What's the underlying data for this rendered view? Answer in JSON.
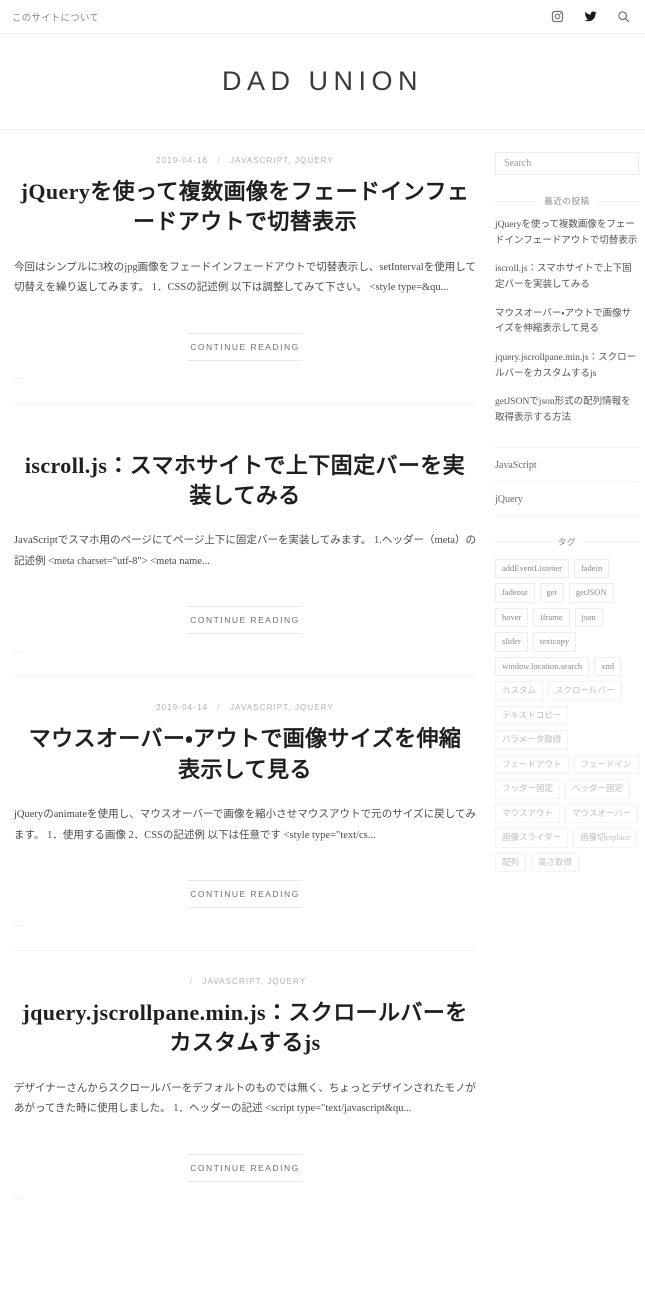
{
  "topbar": {
    "nav": [
      {
        "label": "このサイトについて",
        "name": "nav-about"
      }
    ],
    "icons": [
      {
        "name": "instagram-icon",
        "label": "Instagram"
      },
      {
        "name": "twitter-icon",
        "label": "Twitter"
      },
      {
        "name": "search-icon",
        "label": "Search"
      }
    ]
  },
  "masthead": {
    "site_title": "DAD UNION"
  },
  "posts": [
    {
      "date": "2019-04-16",
      "separator": "/",
      "categories": "JAVASCRIPT, JQUERY",
      "title": "jQueryを使って複数画像をフェードインフェードアウトで切替表示",
      "excerpt": "今回はシンプルに3枚のjpg画像をフェードインフェードアウトで切替表示し、setIntervalを使用して切替えを繰り返してみます。 1．CSSの記述例 以下は調整してみて下さい。 <style type=&qu...",
      "readmore": "CONTINUE READING",
      "footer": "..."
    },
    {
      "date": "",
      "separator": "",
      "categories": "",
      "title": "iscroll.js：スマホサイトで上下固定バーを実装してみる",
      "excerpt": "JavaScriptでスマホ用のページにてページ上下に固定バーを実装してみます。 1.ヘッダー（meta）の記述例 <meta charset=\"utf-8\"> <meta name...",
      "readmore": "CONTINUE READING",
      "footer": "..."
    },
    {
      "date": "2019-04-14",
      "separator": "/",
      "categories": "JAVASCRIPT, JQUERY",
      "title": "マウスオーバー・アウトで画像サイズを伸縮表示して見る",
      "excerpt": "jQueryのanimateを使用し、マウスオーバーで画像を縮小させマウスアウトで元のサイズに戻してみます。 1．使用する画像 2．CSSの記述例 以下は任意です <style type=\"text/cs...",
      "readmore": "CONTINUE READING",
      "footer": "..."
    },
    {
      "date": "",
      "separator": "/",
      "categories": "JAVASCRIPT, JQUERY",
      "title": "jquery.jscrollpane.min.js：スクロールバーをカスタムするjs",
      "excerpt": "デザイナーさんからスクロールバーをデフォルトのものでは無く、ちょっとデザインされたモノがあがってきた時に使用しました。 1．ヘッダーの記述 <script type=\"text/javascript&qu...",
      "readmore": "CONTINUE READING",
      "footer": "..."
    }
  ],
  "sidebar": {
    "search": {
      "placeholder": "Search",
      "value": ""
    },
    "recent": {
      "title": "最近の投稿",
      "items": [
        {
          "label": "jQueryを使って複数画像をフェードインフェードアウトで切替表示"
        },
        {
          "label": "iscroll.js：スマホサイトで上下固定バーを実装してみる"
        },
        {
          "label": "マウスオーバー・アウトで画像サイズを伸縮表示して見る"
        },
        {
          "label": "jquery.jscrollpane.min.js：スクロールバーをカスタムするjs"
        },
        {
          "label": "getJSONでjson形式の配列情報を取得表示する方法"
        }
      ]
    },
    "categories": {
      "title": "",
      "items": [
        {
          "label": "JavaScript"
        },
        {
          "label": "jQuery"
        }
      ]
    },
    "tags": {
      "title": "タグ",
      "items": [
        {
          "label": "addEventListener",
          "jp": false
        },
        {
          "label": "fadein",
          "jp": false
        },
        {
          "label": "fadeout",
          "jp": false
        },
        {
          "label": "get",
          "jp": false
        },
        {
          "label": "getJSON",
          "jp": false
        },
        {
          "label": "hover",
          "jp": false
        },
        {
          "label": "iframe",
          "jp": false
        },
        {
          "label": "json",
          "jp": false
        },
        {
          "label": "slider",
          "jp": false
        },
        {
          "label": "textcopy",
          "jp": false
        },
        {
          "label": "window.location.search",
          "jp": false
        },
        {
          "label": "xml",
          "jp": false
        },
        {
          "label": "カスタム",
          "jp": true
        },
        {
          "label": "スクロールバー",
          "jp": true
        },
        {
          "label": "テキストコピー",
          "jp": true
        },
        {
          "label": "パラメータ取得",
          "jp": true
        },
        {
          "label": "フェードアウト",
          "jp": true
        },
        {
          "label": "フェードイン",
          "jp": true
        },
        {
          "label": "フッター固定",
          "jp": true
        },
        {
          "label": "ヘッダー固定",
          "jp": true
        },
        {
          "label": "マウスアウト",
          "jp": true
        },
        {
          "label": "マウスオーバー",
          "jp": true
        },
        {
          "label": "画像スライダー",
          "jp": true
        },
        {
          "label": "画像切replace",
          "jp": true
        },
        {
          "label": "配列",
          "jp": true
        },
        {
          "label": "高さ取得",
          "jp": true
        }
      ]
    }
  }
}
